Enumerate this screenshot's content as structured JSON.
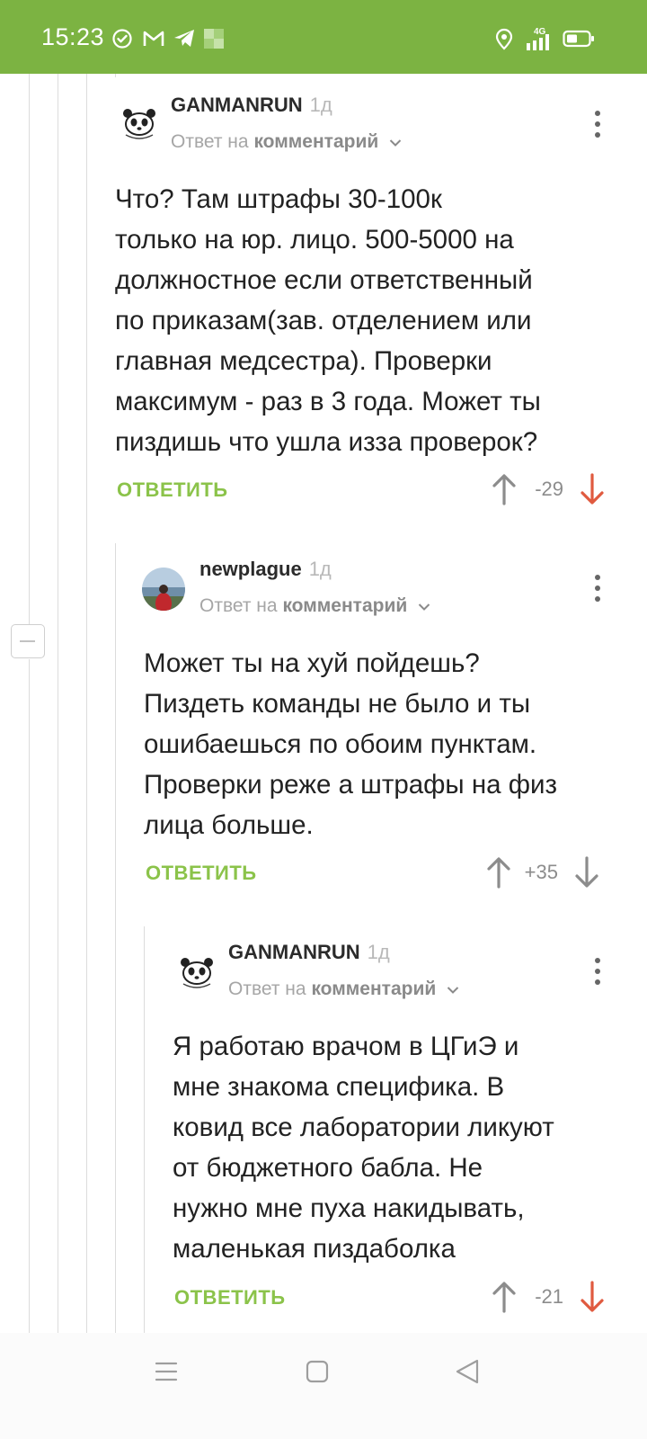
{
  "status": {
    "time": "15:23",
    "network": "4G"
  },
  "comments": [
    {
      "author": "GANMANRUN",
      "age": "1д",
      "reply_prefix": "Ответ на",
      "reply_target": "комментарий",
      "text": "Что? Там штрафы 30-100к\nтолько на юр. лицо. 500-5000 на\nдолжностное если ответственный\nпо приказам(зав. отделением или\nглавная медсестра). Проверки\nмаксимум - раз в 3 года. Может ты\nпиздишь что ушла изза проверок?",
      "reply_label": "ОТВЕТИТЬ",
      "score": "-29",
      "vote_state": "downvoted",
      "avatar": "panda-avatar"
    },
    {
      "author": "newplague",
      "age": "1д",
      "reply_prefix": "Ответ на",
      "reply_target": "комментарий",
      "text": "Может ты на хуй пойдешь?\nПиздеть команды не было и ты\nошибаешься по обоим пунктам.\nПроверки реже а штрафы на физ\nлица больше.",
      "reply_label": "ОТВЕТИТЬ",
      "score": "+35",
      "vote_state": "none",
      "avatar": "photo-avatar"
    },
    {
      "author": "GANMANRUN",
      "age": "1д",
      "reply_prefix": "Ответ на",
      "reply_target": "комментарий",
      "text": "Я работаю врачом в ЦГиЭ и\nмне знакома специфика. В\nковид все лаборатории ликуют\nот бюджетного бабла. Не\nнужно мне пуха накидывать,\nмаленькая пиздаболка",
      "reply_label": "ОТВЕТИТЬ",
      "score": "-21",
      "vote_state": "downvoted",
      "avatar": "panda-avatar"
    }
  ],
  "colors": {
    "status_bar": "#7cb342",
    "reply_button": "#8bc34a",
    "downvote_active": "#e05a3f",
    "vote_idle": "#8c8c8c"
  }
}
